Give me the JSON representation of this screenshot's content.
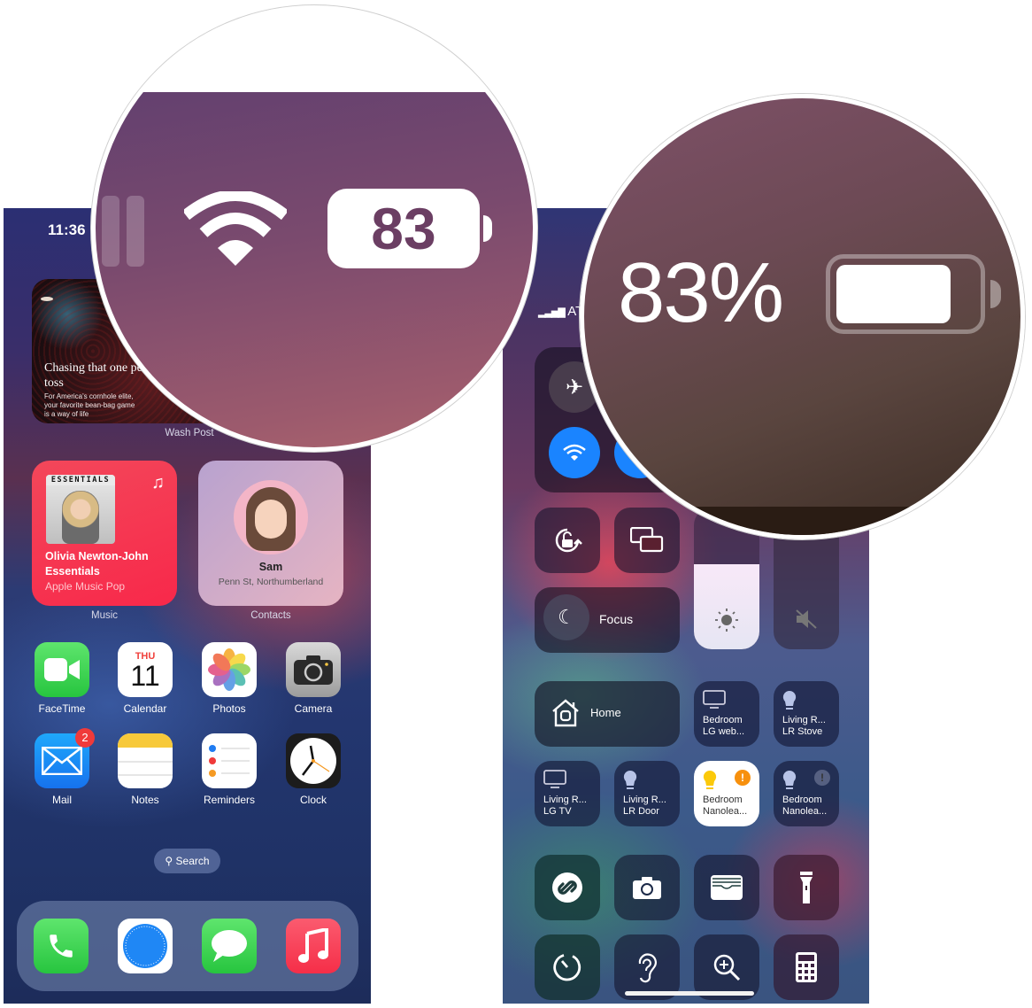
{
  "home_screen": {
    "status_bar": {
      "time": "11:36"
    },
    "news_widget": {
      "headline": "Chasing that one perfect toss",
      "summary": "For America's cornhole elite, your favorite bean-bag game is a way of life",
      "label": "Wash Post"
    },
    "music_widget": {
      "album_badge": "ESSENTIALS",
      "title": "Olivia Newton-John Essentials",
      "subtitle": "Apple Music Pop",
      "label": "Music",
      "icon": "music-note-icon"
    },
    "contacts_widget": {
      "name": "Sam",
      "address": "Penn St, Northumberland",
      "label": "Contacts"
    },
    "apps": [
      {
        "label": "FaceTime",
        "icon": "facetime-icon"
      },
      {
        "label": "Calendar",
        "icon": "calendar-icon",
        "weekday": "THU",
        "day": "11"
      },
      {
        "label": "Photos",
        "icon": "photos-icon"
      },
      {
        "label": "Camera",
        "icon": "camera-icon"
      },
      {
        "label": "Mail",
        "icon": "mail-icon",
        "badge": "2"
      },
      {
        "label": "Notes",
        "icon": "notes-icon"
      },
      {
        "label": "Reminders",
        "icon": "reminders-icon"
      },
      {
        "label": "Clock",
        "icon": "clock-icon"
      }
    ],
    "search": {
      "label": "Search"
    },
    "dock": [
      {
        "name": "Phone",
        "icon": "phone-icon"
      },
      {
        "name": "Safari",
        "icon": "safari-icon"
      },
      {
        "name": "Messages",
        "icon": "messages-icon"
      },
      {
        "name": "Music",
        "icon": "music-icon"
      }
    ]
  },
  "magnifier_home": {
    "battery_level": "83",
    "wifi": "wifi-icon"
  },
  "control_center": {
    "carrier": "AT",
    "connectivity": {
      "airplane_mode": false,
      "wifi": true,
      "bluetooth": true
    },
    "focus": {
      "label": "Focus"
    },
    "brightness_level": 0.6,
    "volume_muted": true,
    "home": {
      "label": "Home"
    },
    "accessories": [
      {
        "line1": "Bedroom",
        "line2": "LG web...",
        "icon": "tv-icon",
        "on": false
      },
      {
        "line1": "Living R...",
        "line2": "LR Stove",
        "icon": "lightbulb-icon",
        "on": false
      },
      {
        "line1": "Living R...",
        "line2": "LG TV",
        "icon": "tv-icon",
        "on": false
      },
      {
        "line1": "Living R...",
        "line2": "LR Door",
        "icon": "lightbulb-icon",
        "on": false
      },
      {
        "line1": "Bedroom",
        "line2": "Nanolea...",
        "icon": "lightbulb-icon",
        "on": true,
        "alert": true
      },
      {
        "line1": "Bedroom",
        "line2": "Nanolea...",
        "icon": "lightbulb-icon",
        "on": false,
        "alert": true
      }
    ],
    "shortcuts": [
      "shazam-icon",
      "camera-icon",
      "wallet-icon",
      "flashlight-icon",
      "timer-icon",
      "hearing-icon",
      "magnifier-icon",
      "calculator-icon"
    ]
  },
  "magnifier_control_center": {
    "battery_percent": "83%",
    "battery_level": 0.83
  }
}
